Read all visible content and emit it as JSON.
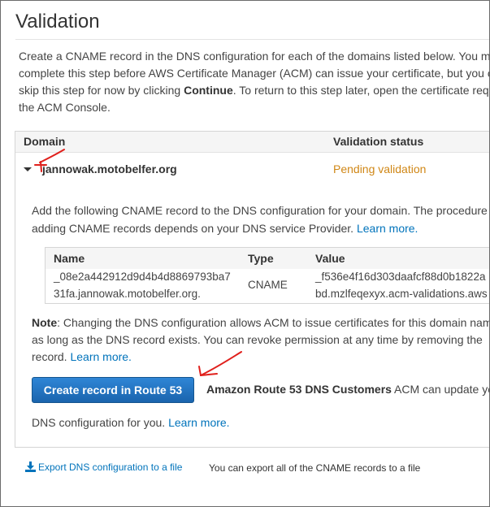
{
  "page": {
    "title": "Validation",
    "intro": {
      "line1": "Create a CNAME record in the DNS configuration for each of the domains listed below. You m",
      "line2": "complete this step before AWS Certificate Manager (ACM) can issue your certificate, but you c",
      "line3_pre": "skip this step for now by clicking ",
      "line3_bold": "Continue",
      "line3_post": ". To return to this step later, open the certificate req",
      "line4": "the ACM Console."
    }
  },
  "domains_table": {
    "col_domain": "Domain",
    "col_status": "Validation status",
    "row": {
      "domain": "jannowak.motobelfer.org",
      "status": "Pending validation",
      "status_color": "#d08716"
    }
  },
  "detail": {
    "line1": "Add the following CNAME record to the DNS configuration for your domain. The procedure",
    "line2_pre": "adding CNAME records depends on your DNS service Provider. ",
    "learn_more": "Learn more."
  },
  "cname_table": {
    "col_name": "Name",
    "col_type": "Type",
    "col_value": "Value",
    "name_line1": "_08e2a442912d9d4b4d8869793ba7",
    "name_line2": "31fa.jannowak.motobelfer.org.",
    "type": "CNAME",
    "value_line1": "_f536e4f16d303daafcf88d0b1822a",
    "value_line2": "bd.mzlfeqexyx.acm-validations.aws"
  },
  "note": {
    "label": "Note",
    "line1": ": Changing the DNS configuration allows ACM to issue certificates for this domain nam",
    "line2": "as long as the DNS record exists. You can revoke permission at any time by removing the",
    "line3_pre": "record. ",
    "learn_more": "Learn more."
  },
  "route53": {
    "button_label": "Create record in Route 53",
    "text_bold": "Amazon Route 53 DNS Customers",
    "text_rest": " ACM can update yo",
    "line2_pre": "DNS configuration for you. ",
    "learn_more": "Learn more."
  },
  "export": {
    "link_label": "Export DNS configuration to a file",
    "note": "You can export all of the CNAME records to a file"
  },
  "colors": {
    "link": "#0073bb",
    "button": "#1d74c6",
    "annotation": "#e0201c"
  }
}
